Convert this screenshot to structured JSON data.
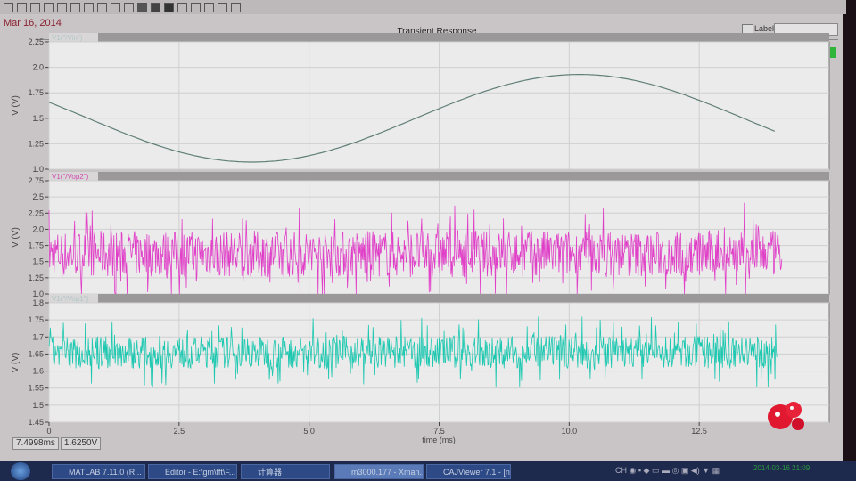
{
  "header": {
    "date": "Mar 16, 2014",
    "title": "Transient Response",
    "label_checkbox": "Label",
    "label_input_value": ""
  },
  "readout": {
    "x_value": "7.4998ms",
    "y_value": "1.6250V"
  },
  "taskbar": {
    "items": [
      "MATLAB  7.11.0 (R...",
      "Editor - E:\\gm\\fft\\F...",
      "计算器",
      "m3000.177 - Xman...",
      "CAJViewer 7.1 - [n..."
    ],
    "tray_lang": "CH",
    "clock": "2014-03-16  21:09"
  },
  "colors": {
    "sine": "#5f7f78",
    "pink": "#e040c8",
    "teal": "#1cc8b0",
    "grid": "#cfd0d0",
    "plot_bg": "#ecebeb"
  },
  "chart_data": [
    {
      "type": "line",
      "legend": "V1(\"/Vin\")",
      "ylabel": "V (V)",
      "xlabel": "time (ms)",
      "ylim": [
        1.0,
        2.25
      ],
      "yticks": [
        "2.25",
        "2.0",
        "1.75",
        "1.5",
        "1.25",
        "1.0"
      ],
      "x": [
        0,
        1,
        2,
        3,
        4,
        5,
        6,
        7,
        8,
        9,
        10,
        11,
        12,
        13,
        14
      ],
      "values": [
        1.6,
        1.48,
        1.28,
        1.12,
        1.08,
        1.12,
        1.25,
        1.42,
        1.6,
        1.77,
        1.9,
        1.92,
        1.82,
        1.62,
        1.32
      ]
    },
    {
      "type": "line",
      "legend": "V1(\"/Vop2\")",
      "ylabel": "V (V)",
      "ylim": [
        1.0,
        2.75
      ],
      "yticks": [
        "2.75",
        "2.5",
        "2.25",
        "2.0",
        "1.75",
        "1.5",
        "1.25",
        "1.0"
      ],
      "description_values": {
        "mean": 1.62,
        "min": 0.95,
        "max": 2.55,
        "x_end": 14.1
      }
    },
    {
      "type": "line",
      "legend": "V1(\"/Vop1\")",
      "ylabel": "V (V)",
      "ylim": [
        1.45,
        1.8
      ],
      "yticks": [
        "1.8",
        "1.75",
        "1.7",
        "1.65",
        "1.6",
        "1.55",
        "1.5",
        "1.45"
      ],
      "description_values": {
        "mean": 1.655,
        "min": 1.55,
        "max": 1.76,
        "x_end": 14.0
      }
    }
  ],
  "xaxis": {
    "label": "time (ms)",
    "xlim": [
      0,
      15
    ],
    "ticks": [
      "0",
      "2.5",
      "5.0",
      "7.5",
      "10.0",
      "12.5"
    ]
  }
}
